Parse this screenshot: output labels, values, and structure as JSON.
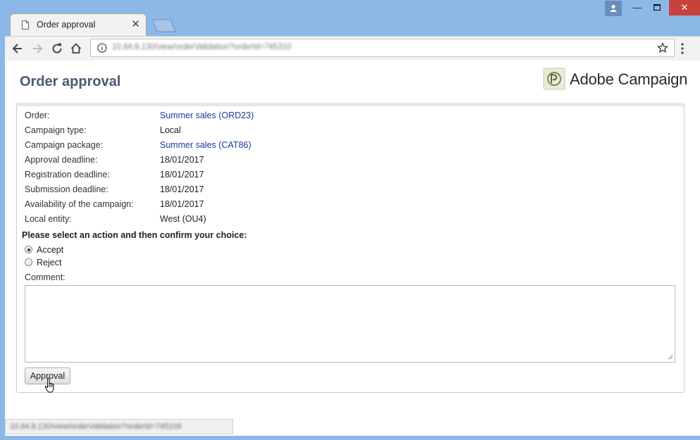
{
  "browser": {
    "tab_title": "Order approval",
    "url": "10.84.8.130/view/orderValidation?orderId=745310",
    "status_url": "10.84.8.130/view/orderValidation?orderId=745109"
  },
  "page": {
    "title": "Order approval",
    "logo_text": "Adobe Campaign"
  },
  "details": [
    {
      "label": "Order:",
      "value": "Summer sales (ORD23)",
      "link": true
    },
    {
      "label": "Campaign type:",
      "value": "Local",
      "link": false
    },
    {
      "label": "Campaign package:",
      "value": "Summer sales (CAT86)",
      "link": true
    },
    {
      "label": "Approval deadline:",
      "value": "18/01/2017",
      "link": false
    },
    {
      "label": "Registration deadline:",
      "value": "18/01/2017",
      "link": false
    },
    {
      "label": "Submission deadline:",
      "value": "18/01/2017",
      "link": false
    },
    {
      "label": "Availability of the campaign:",
      "value": "18/01/2017",
      "link": false
    },
    {
      "label": "Local entity:",
      "value": "West (OU4)",
      "link": false
    }
  ],
  "action": {
    "prompt": "Please select an action and then confirm your choice:",
    "options": [
      {
        "label": "Accept",
        "checked": true
      },
      {
        "label": "Reject",
        "checked": false
      }
    ],
    "comment_label": "Comment:",
    "comment_value": "",
    "submit_label": "Approval"
  }
}
